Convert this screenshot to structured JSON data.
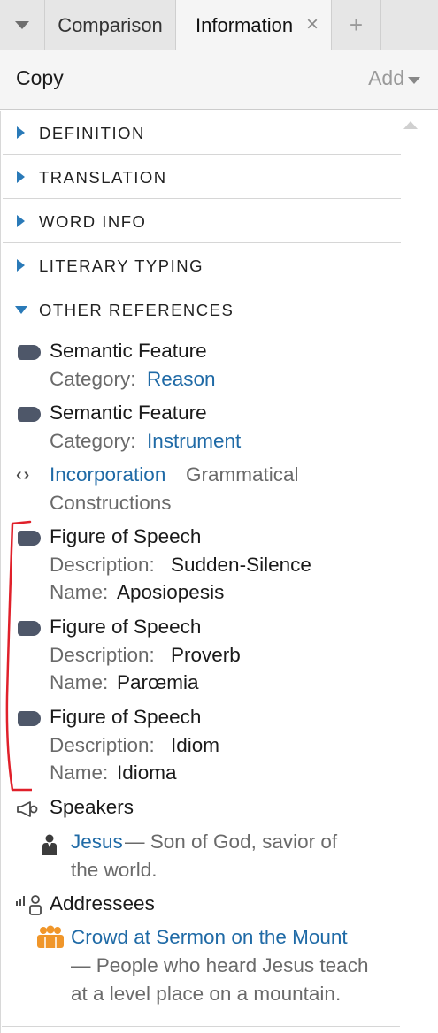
{
  "tabbar": {
    "menu_icon": "dropdown-triangle-icon",
    "tabs": [
      {
        "label": "Comparison"
      },
      {
        "label": "Information",
        "close": "×"
      }
    ],
    "add_label": "+"
  },
  "toolbar": {
    "copy_label": "Copy",
    "add_label": "Add"
  },
  "sections": [
    {
      "label": "DEFINITION",
      "expanded": false
    },
    {
      "label": "TRANSLATION",
      "expanded": false
    },
    {
      "label": "WORD INFO",
      "expanded": false
    },
    {
      "label": "LITERARY TYPING",
      "expanded": false
    },
    {
      "label": "OTHER REFERENCES",
      "expanded": true
    }
  ],
  "references": {
    "sf1": {
      "title": "Semantic Feature",
      "key": "Category:",
      "value": "Reason"
    },
    "sf2": {
      "title": "Semantic Feature",
      "key": "Category:",
      "value": "Instrument"
    },
    "incorporation": {
      "link": "Incorporation",
      "rest1": "Grammatical",
      "rest2": "Constructions"
    },
    "fs1": {
      "title": "Figure of Speech",
      "desc_key": "Description:",
      "desc_val": "Sudden-Silence",
      "name_key": "Name:",
      "name_val": "Aposiopesis"
    },
    "fs2": {
      "title": "Figure of Speech",
      "desc_key": "Description:",
      "desc_val": "Proverb",
      "name_key": "Name:",
      "name_val": "Parœmia"
    },
    "fs3": {
      "title": "Figure of Speech",
      "desc_key": "Description:",
      "desc_val": "Idiom",
      "name_key": "Name:",
      "name_val": "Idioma"
    },
    "speakers": {
      "title": "Speakers",
      "name": "Jesus",
      "desc1": " — Son of God, savior of",
      "desc2": "the world."
    },
    "addressees": {
      "title": "Addressees",
      "name": "Crowd at Sermon on the Mount",
      "desc1": "— People who heard Jesus teach",
      "desc2": "at a level place on a mountain."
    }
  },
  "colors": {
    "accent": "#2a7ab8",
    "link": "#1f6aa6",
    "tag": "#4e5769",
    "annotation": "#e0202a",
    "crowd": "#f0962a"
  }
}
